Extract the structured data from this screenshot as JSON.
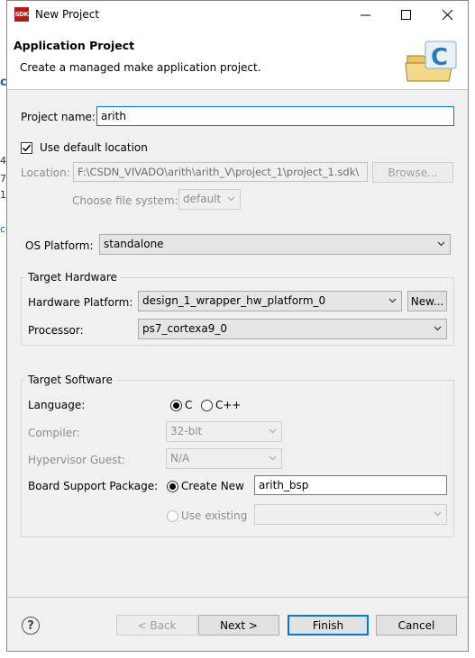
{
  "window": {
    "title": "New Project",
    "icon_text": "SDK"
  },
  "header": {
    "title": "Application Project",
    "description": "Create a managed make application project."
  },
  "background_app": {
    "fragments": [
      "cf",
      "4",
      "7",
      "1",
      "cc"
    ]
  },
  "project": {
    "name_label": "Project name:",
    "name_value": "arith",
    "use_default_location_label": "Use default location",
    "use_default_location_checked": true,
    "location_label": "Location:",
    "location_value": "F:\\CSDN_VIVADO\\arith\\arith_V\\project_1\\project_1.sdk\\",
    "browse_label": "Browse...",
    "file_system_label": "Choose file system:",
    "file_system_value": "default"
  },
  "os_platform": {
    "label": "OS Platform:",
    "value": "standalone"
  },
  "target_hardware": {
    "group_title": "Target Hardware",
    "platform_label": "Hardware Platform:",
    "platform_value": "design_1_wrapper_hw_platform_0",
    "new_button": "New...",
    "processor_label": "Processor:",
    "processor_value": "ps7_cortexa9_0"
  },
  "target_software": {
    "group_title": "Target Software",
    "language_label": "Language:",
    "language_options": [
      "C",
      "C++"
    ],
    "language_selected": "C",
    "compiler_label": "Compiler:",
    "compiler_value": "32-bit",
    "hypervisor_label": "Hypervisor Guest:",
    "hypervisor_value": "N/A",
    "bsp_label": "Board Support Package:",
    "create_new_label": "Create New",
    "bsp_name": "arith_bsp",
    "use_existing_label": "Use existing"
  },
  "buttons": {
    "back": "< Back",
    "next": "Next >",
    "finish": "Finish",
    "cancel": "Cancel",
    "help": "?"
  },
  "colors": {
    "dialog_bg": "#f0f0f0",
    "focus_border": "#0078d7",
    "sdk_icon": "#b31b1b"
  }
}
